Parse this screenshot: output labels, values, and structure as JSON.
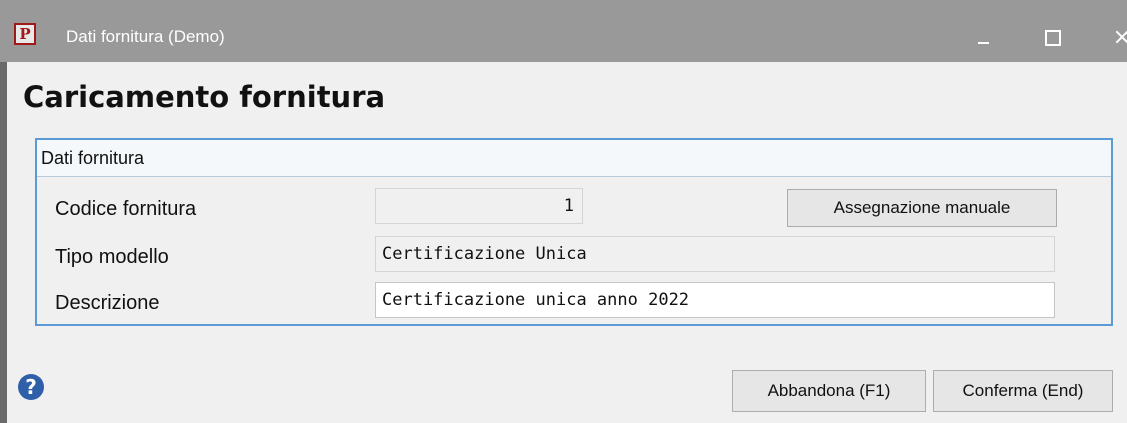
{
  "window": {
    "title": "Dati fornitura  (Demo)",
    "app_icon_letter": "P"
  },
  "heading": "Caricamento fornitura",
  "group": {
    "title": "Dati fornitura",
    "fields": {
      "codice": {
        "label": "Codice fornitura",
        "value": "1"
      },
      "tipo": {
        "label": "Tipo modello",
        "value": "Certificazione Unica"
      },
      "descrizione": {
        "label": "Descrizione",
        "value": "Certificazione unica anno 2022"
      }
    },
    "manual_button_label": "Assegnazione manuale"
  },
  "footer": {
    "help_glyph": "?",
    "abandon_label": "Abbandona (F1)",
    "confirm_label": "Conferma (End)"
  },
  "colors": {
    "titlebar": "#999999",
    "group_border": "#5b9bd5",
    "help_icon": "#2f5fa8"
  }
}
